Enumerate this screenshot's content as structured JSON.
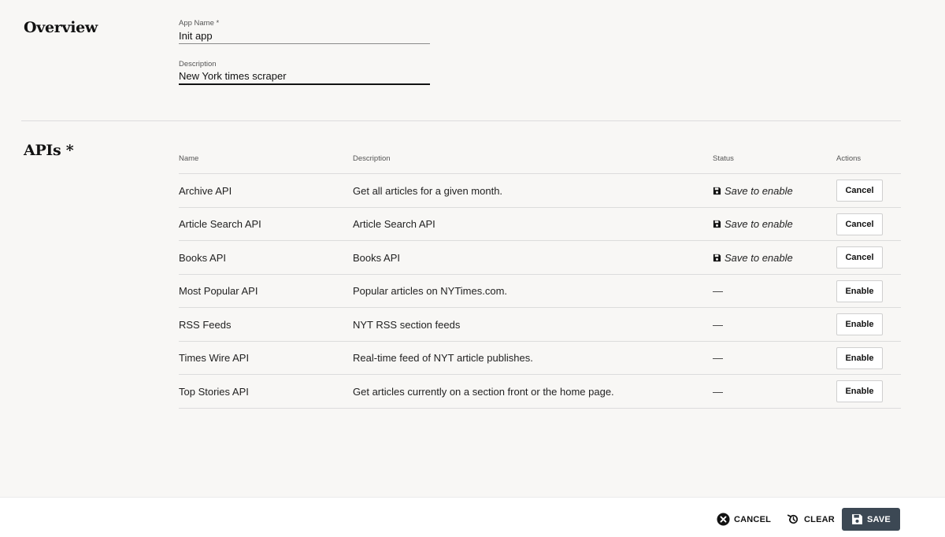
{
  "overview": {
    "title": "Overview",
    "app_name": {
      "label": "App Name *",
      "value": "Init app"
    },
    "description": {
      "label": "Description",
      "value": "New York times scraper"
    }
  },
  "apis": {
    "title": "APIs *",
    "columns": {
      "name": "Name",
      "description": "Description",
      "status": "Status",
      "actions": "Actions"
    },
    "rows": [
      {
        "name": "Archive API",
        "description": "Get all articles for a given month.",
        "status": "Save to enable",
        "action": "Cancel"
      },
      {
        "name": "Article Search API",
        "description": "Article Search API",
        "status": "Save to enable",
        "action": "Cancel"
      },
      {
        "name": "Books API",
        "description": "Books API",
        "status": "Save to enable",
        "action": "Cancel"
      },
      {
        "name": "Most Popular API",
        "description": "Popular articles on NYTimes.com.",
        "status": "—",
        "action": "Enable"
      },
      {
        "name": "RSS Feeds",
        "description": "NYT RSS section feeds",
        "status": "—",
        "action": "Enable"
      },
      {
        "name": "Times Wire API",
        "description": "Real-time feed of NYT article publishes.",
        "status": "—",
        "action": "Enable"
      },
      {
        "name": "Top Stories API",
        "description": "Get articles currently on a section front or the home page.",
        "status": "—",
        "action": "Enable"
      }
    ]
  },
  "footer": {
    "cancel_label": "CANCEL",
    "clear_label": "CLEAR",
    "save_label": "SAVE"
  },
  "icons": {
    "status_pending": "floppy-disk-icon",
    "cancel": "close-circle-icon",
    "clear": "undo-icon",
    "save": "floppy-disk-icon"
  },
  "colors": {
    "background": "#f8f7f5",
    "save_button": "#3c4854",
    "text": "#121212"
  }
}
